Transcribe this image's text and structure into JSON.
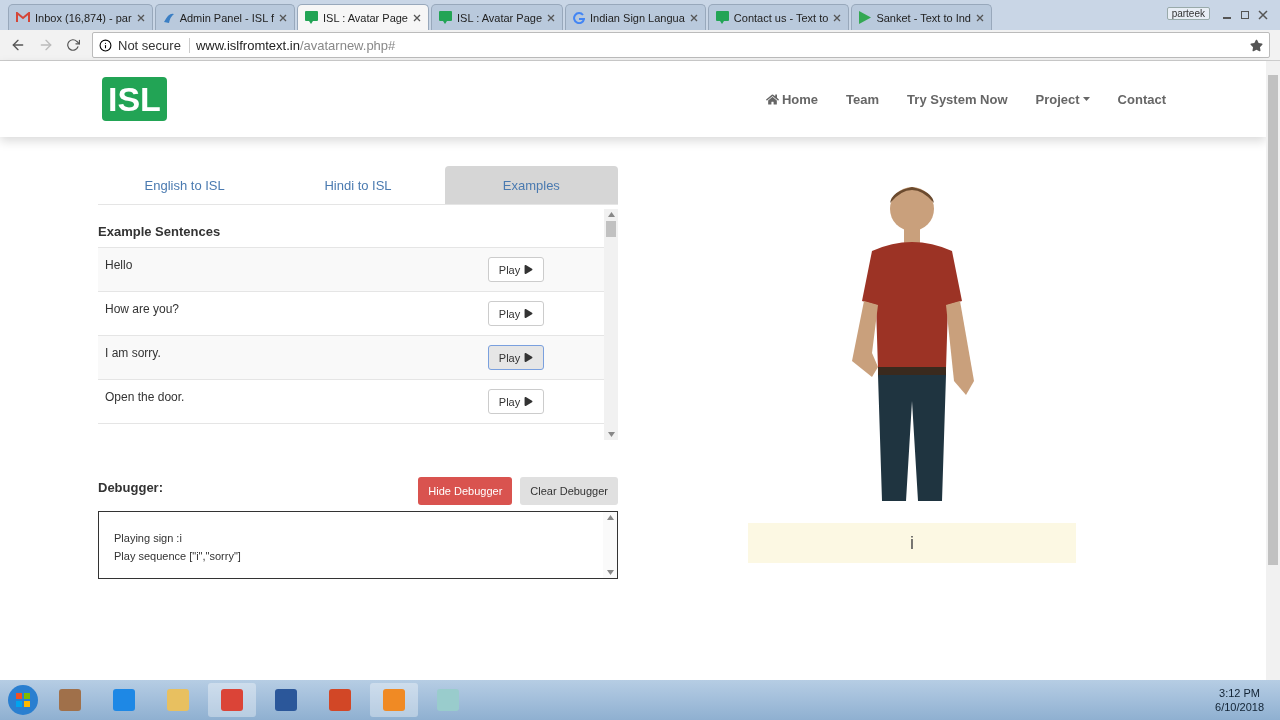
{
  "browser": {
    "tabs": [
      {
        "title": "Inbox (16,874) - par",
        "kind": "mail",
        "selected": false
      },
      {
        "title": "Admin Panel - ISL f",
        "kind": "admin",
        "selected": false
      },
      {
        "title": "ISL : Avatar Page",
        "kind": "isl",
        "selected": true
      },
      {
        "title": "ISL : Avatar Page",
        "kind": "isl",
        "selected": false
      },
      {
        "title": "Indian Sign Langua",
        "kind": "google",
        "selected": false
      },
      {
        "title": "Contact us - Text to",
        "kind": "isl",
        "selected": false
      },
      {
        "title": "Sanket - Text to Ind",
        "kind": "play",
        "selected": false
      }
    ],
    "user": "parteek",
    "security": "Not secure",
    "url_host": "www.islfromtext.in",
    "url_path": "/avatarnew.php#"
  },
  "header": {
    "logo": "ISL",
    "nav": [
      {
        "label": "Home",
        "kind": "home"
      },
      {
        "label": "Team",
        "kind": "plain"
      },
      {
        "label": "Try System Now",
        "kind": "plain"
      },
      {
        "label": "Project",
        "kind": "dropdown"
      },
      {
        "label": "Contact",
        "kind": "plain"
      }
    ]
  },
  "tabs": [
    {
      "label": "English to ISL",
      "selected": false
    },
    {
      "label": "Hindi to ISL",
      "selected": false
    },
    {
      "label": "Examples",
      "selected": true
    }
  ],
  "examples": {
    "heading": "Example Sentences",
    "rows": [
      {
        "sentence": "Hello",
        "button": "Play",
        "focused": false
      },
      {
        "sentence": "How are you?",
        "button": "Play",
        "focused": false
      },
      {
        "sentence": "I am sorry.",
        "button": "Play",
        "focused": true
      },
      {
        "sentence": "Open the door.",
        "button": "Play",
        "focused": false
      }
    ]
  },
  "debugger": {
    "label": "Debugger:",
    "hide_button": "Hide Debugger",
    "clear_button": "Clear Debugger",
    "lines": [
      "Playing sign :i",
      "Play sequence [\"i\",\"sorry\"]"
    ]
  },
  "avatar": {
    "caption": "i"
  },
  "taskbar": {
    "time": "3:12 PM",
    "date": "6/10/2018"
  }
}
